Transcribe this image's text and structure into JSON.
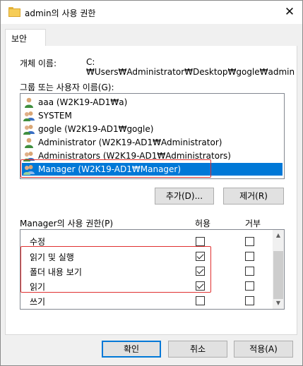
{
  "window": {
    "title": "admin의 사용 권한",
    "close_glyph": "✕"
  },
  "tabs": [
    {
      "label": "보안"
    }
  ],
  "object": {
    "label": "개체 이름:",
    "value": "C:₩Users₩Administrator₩Desktop₩gogle₩admin"
  },
  "groups": {
    "label": "그룹 또는 사용자 이름(G):",
    "items": [
      {
        "name": "aaa (W2K19-AD1₩a)",
        "icon": "user-icon",
        "selected": false
      },
      {
        "name": "SYSTEM",
        "icon": "group-icon",
        "selected": false
      },
      {
        "name": "gogle (W2K19-AD1₩gogle)",
        "icon": "group-icon",
        "selected": false
      },
      {
        "name": "Administrator (W2K19-AD1₩Administrator)",
        "icon": "user-icon",
        "selected": false
      },
      {
        "name": "Administrators (W2K19-AD1₩Administrators)",
        "icon": "group-icon",
        "selected": false
      },
      {
        "name": "Manager (W2K19-AD1₩Manager)",
        "icon": "group-icon",
        "selected": true
      }
    ]
  },
  "group_buttons": {
    "add": "추가(D)...",
    "remove": "제거(R)"
  },
  "permissions": {
    "title": "Manager의 사용 권한(P)",
    "allow_header": "허용",
    "deny_header": "거부",
    "rows": [
      {
        "name": "수정",
        "allow": false,
        "deny": false
      },
      {
        "name": "읽기 및 실행",
        "allow": true,
        "deny": false
      },
      {
        "name": "폴더 내용 보기",
        "allow": true,
        "deny": false
      },
      {
        "name": "읽기",
        "allow": true,
        "deny": false
      },
      {
        "name": "쓰기",
        "allow": false,
        "deny": false
      }
    ]
  },
  "footer": {
    "ok": "확인",
    "cancel": "취소",
    "apply": "적용(A)"
  },
  "colors": {
    "selection": "#0078d7",
    "highlight_box": "#e03030",
    "folder": "#f6cd57"
  }
}
